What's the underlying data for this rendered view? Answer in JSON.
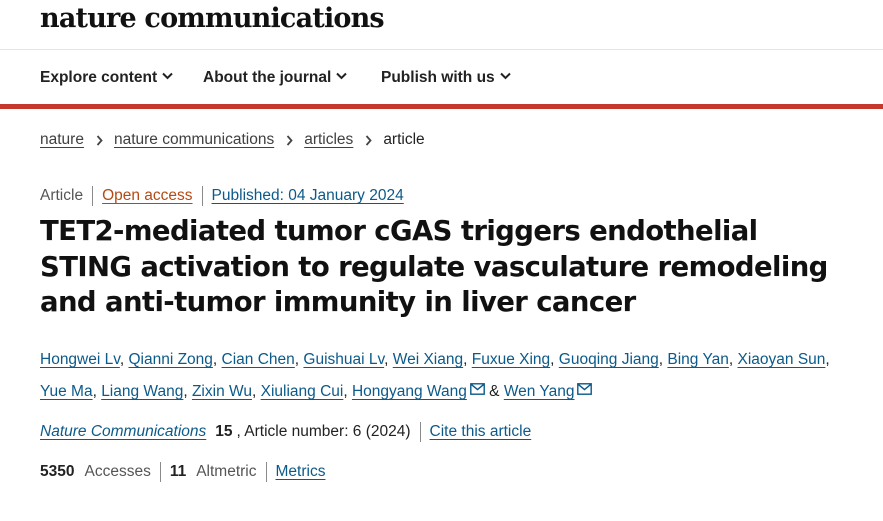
{
  "logo": "nature communications",
  "nav": [
    {
      "label": "Explore content"
    },
    {
      "label": "About the journal"
    },
    {
      "label": "Publish with us"
    }
  ],
  "breadcrumb": [
    "nature",
    "nature communications",
    "articles",
    "article"
  ],
  "meta": {
    "type": "Article",
    "access": "Open access",
    "published": "Published: 04 January 2024"
  },
  "title": "TET2-mediated tumor cGAS triggers endothelial STING activation to regulate vasculature remodeling and anti-tumor immunity in liver cancer",
  "authors": [
    "Hongwei Lv",
    "Qianni Zong",
    "Cian Chen",
    "Guishuai Lv",
    "Wei Xiang",
    "Fuxue Xing",
    "Guoqing Jiang",
    "Bing Yan",
    "Xiaoyan Sun",
    "Yue Ma",
    "Liang Wang",
    "Zixin Wu",
    "Xiuliang Cui",
    "Hongyang Wang",
    "Wen Yang"
  ],
  "author_sep": ",",
  "author_amp": "&",
  "citation": {
    "journal": "Nature Communications",
    "volume": "15",
    "article_number": ", Article number: 6 (2024)",
    "cite_link": "Cite this article"
  },
  "metrics": {
    "accesses_count": "5350",
    "accesses_label": "Accesses",
    "altmetric_count": "11",
    "altmetric_label": "Altmetric",
    "metrics_link": "Metrics"
  },
  "colors": {
    "accent_red": "#c7382c",
    "link_blue": "#0b5a8a",
    "open_access_orange": "#b44a15"
  },
  "icons": [
    "chevron-down-icon",
    "chevron-right-icon",
    "mail-icon"
  ]
}
